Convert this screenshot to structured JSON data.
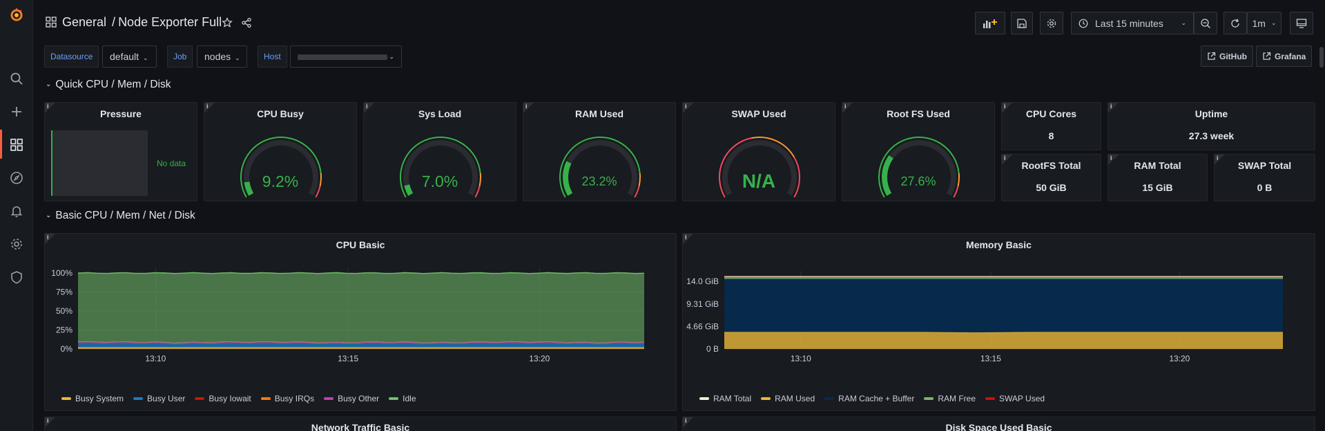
{
  "breadcrumb": {
    "folder": "General",
    "separator": "/",
    "dashboard": "Node Exporter Full"
  },
  "toolbar": {
    "time_range": "Last 15 minutes",
    "refresh": "1m"
  },
  "variables": [
    {
      "label": "Datasource",
      "value": "default"
    },
    {
      "label": "Job",
      "value": "nodes"
    },
    {
      "label": "Host",
      "value": ""
    }
  ],
  "links": {
    "github": "GitHub",
    "grafana": "Grafana"
  },
  "rows": {
    "quick": "Quick CPU / Mem / Disk",
    "basic": "Basic CPU / Mem / Net / Disk"
  },
  "panels": {
    "pressure": {
      "title": "Pressure",
      "nodata": "No data"
    },
    "cpu_busy": {
      "title": "CPU Busy",
      "value": "9.2%",
      "fraction": 0.092
    },
    "sys_load": {
      "title": "Sys Load",
      "value": "7.0%",
      "fraction": 0.07
    },
    "ram_used": {
      "title": "RAM Used",
      "value": "23.2%",
      "fraction": 0.232
    },
    "swap_used": {
      "title": "SWAP Used",
      "value": "N/A",
      "fraction": 0
    },
    "root_fs": {
      "title": "Root FS Used",
      "value": "27.6%",
      "fraction": 0.276
    },
    "cpu_cores": {
      "title": "CPU Cores",
      "value": "8"
    },
    "uptime": {
      "title": "Uptime",
      "value": "27.3 week"
    },
    "rootfs_total": {
      "title": "RootFS Total",
      "value": "50 GiB"
    },
    "ram_total": {
      "title": "RAM Total",
      "value": "15 GiB"
    },
    "swap_total": {
      "title": "SWAP Total",
      "value": "0 B"
    },
    "cpu_basic": {
      "title": "CPU Basic"
    },
    "memory_basic": {
      "title": "Memory Basic"
    },
    "network": {
      "title": "Network Traffic Basic"
    },
    "disk": {
      "title": "Disk Space Used Basic"
    }
  },
  "colors": {
    "accent": "#f55f3e",
    "ok": "#37b14b",
    "warn": "#ff9830",
    "crit": "#f2495c",
    "link": "#6e9fff"
  },
  "chart_data": [
    {
      "type": "area",
      "title": "CPU Basic",
      "y_ticks": [
        "100%",
        "75%",
        "50%",
        "25%",
        "0%"
      ],
      "x_ticks": [
        "13:10",
        "13:15",
        "13:20"
      ],
      "ylim": [
        0,
        100
      ],
      "series": [
        {
          "name": "Busy System",
          "color": "#eab839",
          "values": [
            2,
            2,
            2,
            2,
            2,
            2,
            2,
            2,
            2,
            2,
            2,
            2
          ]
        },
        {
          "name": "Busy User",
          "color": "#1f78c1",
          "values": [
            6,
            6,
            5,
            6,
            6,
            5,
            6,
            5,
            6,
            6,
            5,
            6
          ]
        },
        {
          "name": "Busy Iowait",
          "color": "#bf1b00",
          "values": [
            1,
            1,
            1,
            1,
            1,
            1,
            1,
            1,
            1,
            1,
            1,
            1
          ]
        },
        {
          "name": "Busy IRQs",
          "color": "#ff780a",
          "values": [
            0,
            0,
            0,
            0,
            0,
            0,
            0,
            0,
            0,
            0,
            0,
            0
          ]
        },
        {
          "name": "Busy Other",
          "color": "#ba43a9",
          "values": [
            0,
            0,
            0,
            0,
            0,
            0,
            0,
            0,
            0,
            0,
            0,
            0
          ]
        },
        {
          "name": "Idle",
          "color": "#73bf69",
          "values": [
            91,
            91,
            92,
            91,
            91,
            92,
            91,
            92,
            91,
            91,
            92,
            91
          ]
        }
      ],
      "legend": "bottom"
    },
    {
      "type": "area",
      "title": "Memory Basic",
      "y_ticks": [
        "14.0 GiB",
        "9.31 GiB",
        "4.66 GiB",
        "0 B"
      ],
      "x_ticks": [
        "13:10",
        "13:15",
        "13:20"
      ],
      "ylim": [
        0,
        15
      ],
      "series": [
        {
          "name": "RAM Total",
          "color": "#e0f9d7",
          "values": [
            15,
            15,
            15,
            15,
            15,
            15,
            15,
            15,
            15,
            15,
            15,
            15
          ]
        },
        {
          "name": "RAM Used",
          "color": "#eab839",
          "values": [
            3.5,
            3.5,
            3.5,
            3.5,
            3.5,
            3.4,
            3.5,
            3.5,
            3.5,
            3.5,
            3.5,
            3.5
          ]
        },
        {
          "name": "RAM Cache + Buffer",
          "color": "#052b51",
          "values": [
            11,
            11,
            11,
            11,
            11,
            11.1,
            11,
            11,
            11,
            11,
            11,
            11
          ]
        },
        {
          "name": "RAM Free",
          "color": "#7eb26d",
          "values": [
            0.5,
            0.5,
            0.5,
            0.5,
            0.5,
            0.5,
            0.5,
            0.5,
            0.5,
            0.5,
            0.5,
            0.5
          ]
        },
        {
          "name": "SWAP Used",
          "color": "#cd0f0f",
          "values": [
            0,
            0,
            0,
            0,
            0,
            0,
            0,
            0,
            0,
            0,
            0,
            0
          ]
        }
      ],
      "legend": "bottom"
    }
  ]
}
